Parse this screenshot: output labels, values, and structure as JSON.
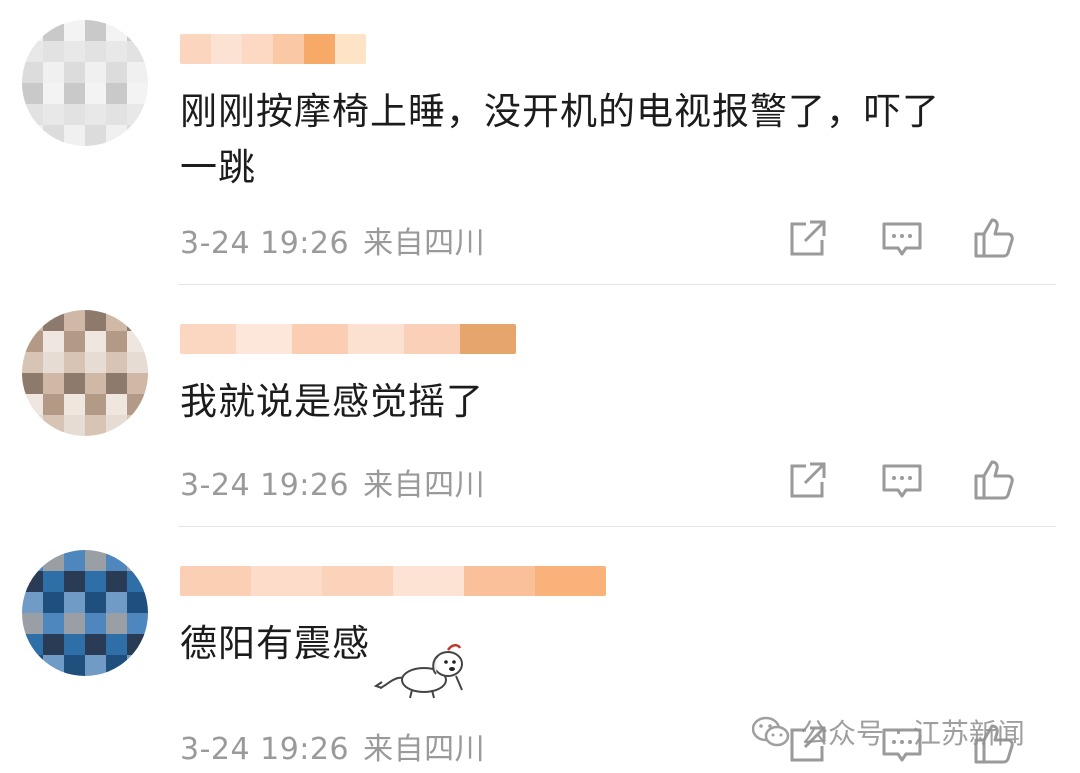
{
  "comments": [
    {
      "text_line1": "刚刚按摩椅上睡，没开机的电视报警了，吓了",
      "text_line2": "一跳",
      "time": "3-24 19:26",
      "location": "来自四川",
      "avatar_colors": [
        "#f3f3f3",
        "#e8e8e8",
        "#dcdcdc",
        "#c9c9c9",
        "#e2e2e2",
        "#f0f0f0"
      ],
      "username_colors": [
        "#fcd5bf",
        "#fbe2d2",
        "#fdd8c3",
        "#fbc8a6",
        "#f7a967",
        "#fde4c6"
      ]
    },
    {
      "text_line1": "我就说是感觉摇了",
      "text_line2": "",
      "time": "3-24 19:26",
      "location": "来自四川",
      "avatar_colors": [
        "#e7dcd3",
        "#cfb8a5",
        "#b39a86",
        "#d8c4b5",
        "#8e7a6d",
        "#efe6df"
      ],
      "username_colors": [
        "#fbd7c2",
        "#fde7da",
        "#fbcdb2",
        "#fde1d0",
        "#fbd0b8",
        "#e6a56d"
      ]
    },
    {
      "text_line1": "德阳有震感",
      "text_line2": "",
      "time": "3-24 19:26",
      "location": "来自四川",
      "avatar_colors": [
        "#2f6fa8",
        "#1f4f7d",
        "#4e87bd",
        "#2a3c55",
        "#6f9bc6",
        "#9a9fa6"
      ],
      "username_colors": [
        "#fbcfb4",
        "#fddcc9",
        "#fbd3bb",
        "#fde3d3",
        "#f9c09a",
        "#f8b27a"
      ]
    }
  ],
  "actions": {
    "share_icon": "share-icon",
    "comment_icon": "comment-icon",
    "like_icon": "thumbs-up-icon"
  },
  "colors": {
    "text": "#1c1c1c",
    "meta": "#9a9a9a",
    "divider": "#e6e6e6"
  },
  "watermark": {
    "account_type": "公众号",
    "separator": "·",
    "account_name": "江苏新闻"
  }
}
